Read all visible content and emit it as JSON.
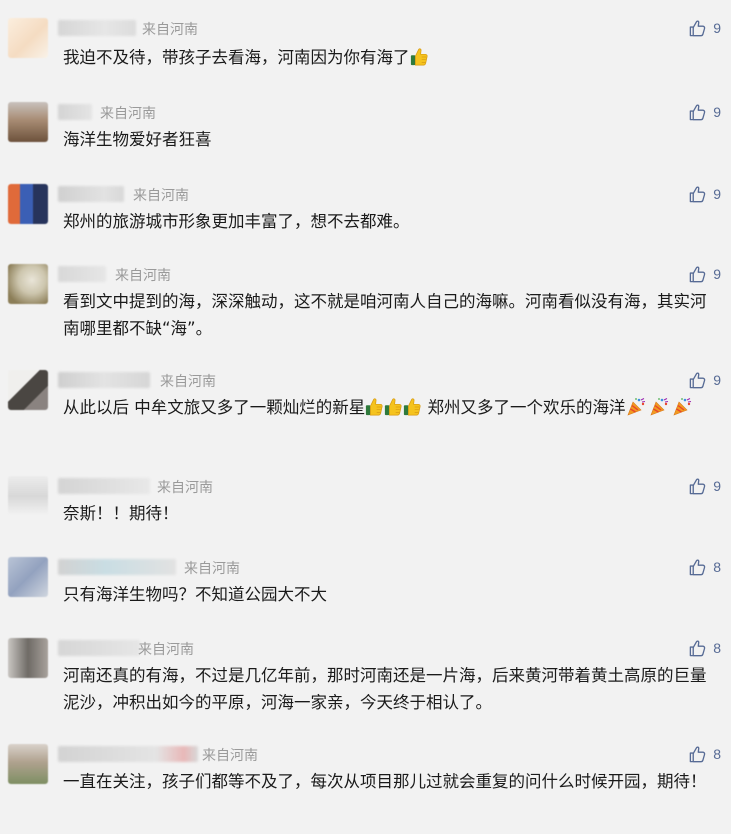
{
  "comments": [
    {
      "source": "来自河南",
      "likes": "9",
      "text": "我迫不及待，带孩子去看海，河南因为你有海了",
      "emoji": [
        "thumbs-up"
      ]
    },
    {
      "source": "来自河南",
      "likes": "9",
      "text": "海洋生物爱好者狂喜"
    },
    {
      "source": "来自河南",
      "likes": "9",
      "text": "郑州的旅游城市形象更加丰富了，想不去都难。"
    },
    {
      "source": "来自河南",
      "likes": "9",
      "text": "看到文中提到的海，深深触动，这不就是咱河南人自己的海嘛。河南看似没有海，其实河南哪里都不缺“海”。"
    },
    {
      "source": "来自河南",
      "likes": "9",
      "text_a": "从此以后 中牟文旅又多了一颗灿烂的新星",
      "text_b": " 郑州又多了一个欢乐的海洋",
      "emoji": [
        "thumbs-up",
        "thumbs-up",
        "thumbs-up",
        "party-popper",
        "party-popper",
        "party-popper"
      ]
    },
    {
      "source": "来自河南",
      "likes": "9",
      "text": "奈斯！！期待！"
    },
    {
      "source": "来自河南",
      "likes": "8",
      "text": "只有海洋生物吗？不知道公园大不大"
    },
    {
      "source": "来自河南",
      "likes": "8",
      "text": "河南还真的有海，不过是几亿年前，那时河南还是一片海，后来黄河带着黄土高原的巨量泥沙，冲积出如今的平原，河海一家亲，今天终于相认了。"
    },
    {
      "source": "来自河南",
      "likes": "8",
      "text": "一直在关注，孩子们都等不及了，每次从项目那儿过就会重复的问什么时候开园，期待！"
    }
  ],
  "colors": {
    "background": "#f2f2f2",
    "source_text": "#9a9a9a",
    "like_accent": "#576b95",
    "body_text": "#1a1a1a"
  },
  "icons": {
    "like": "thumbs-up-outline-icon",
    "avatar": "blurred-avatar",
    "nickname": "blurred-nickname"
  }
}
